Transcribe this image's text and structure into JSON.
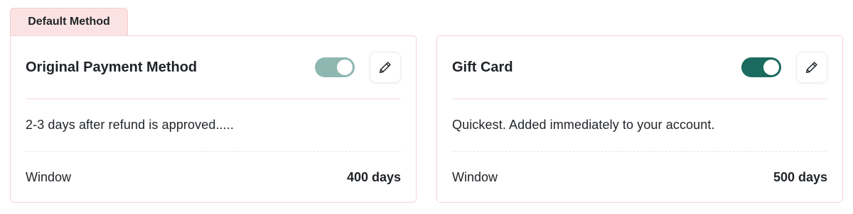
{
  "default_tab": {
    "label": "Default Method"
  },
  "cards": [
    {
      "title": "Original Payment Method",
      "toggle_state": "on-muted",
      "toggle_color": "#8fb7b1",
      "edit_icon": "pencil-icon",
      "description": "2-3 days after refund is approved.....",
      "window_label": "Window",
      "window_value": "400 days"
    },
    {
      "title": "Gift Card",
      "toggle_state": "on",
      "toggle_color": "#1b6a5f",
      "edit_icon": "pencil-icon",
      "description": "Quickest. Added immediately to your account.",
      "window_label": "Window",
      "window_value": "500 days"
    }
  ],
  "colors": {
    "tab_background": "#fbe3e3",
    "card_border": "#f7d3d3"
  }
}
